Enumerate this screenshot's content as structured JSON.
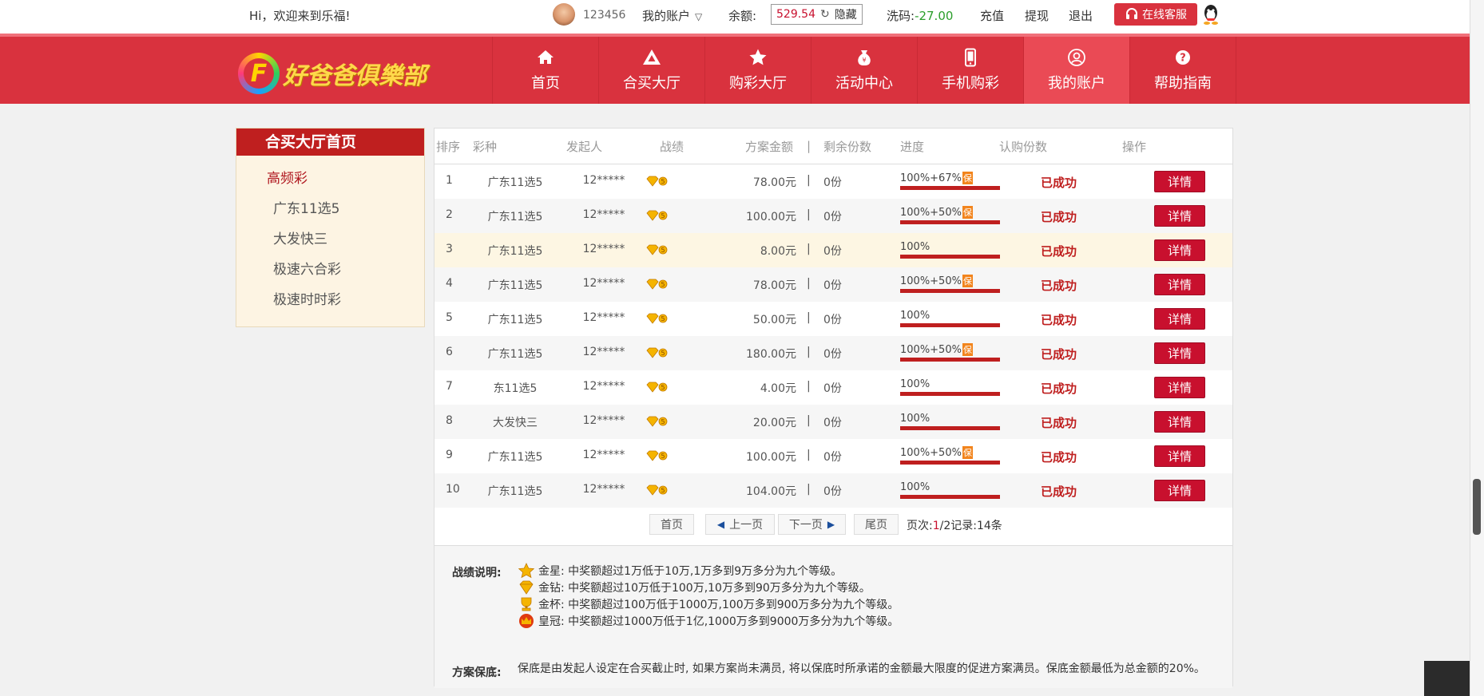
{
  "topbar": {
    "welcome": "Hi，欢迎来到乐福!",
    "user_id": "123456",
    "my_account": "我的账户",
    "balance_label": "余额:",
    "balance_value": "529.54",
    "hide_label": "隐藏",
    "wash_label": "洗码:",
    "wash_value": "-27.00",
    "deposit": "充值",
    "withdraw": "提现",
    "logout": "退出",
    "service": "在线客服"
  },
  "logo": {
    "text": "好爸爸俱樂部"
  },
  "nav": [
    {
      "label": "首页",
      "icon": "home-icon"
    },
    {
      "label": "合买大厅",
      "icon": "triangle-icon"
    },
    {
      "label": "购彩大厅",
      "icon": "star-icon"
    },
    {
      "label": "活动中心",
      "icon": "moneybag-icon"
    },
    {
      "label": "手机购彩",
      "icon": "phone-icon"
    },
    {
      "label": "我的账户",
      "icon": "user-icon"
    },
    {
      "label": "帮助指南",
      "icon": "help-icon"
    }
  ],
  "sidebar": {
    "title": "合买大厅首页",
    "category": "高频彩",
    "items": [
      "广东11选5",
      "大发快三",
      "极速六合彩",
      "极速时时彩"
    ]
  },
  "table": {
    "headers": [
      "排序",
      "彩种",
      "发起人",
      "战绩",
      "方案金额",
      "|",
      "剩余份数",
      "进度",
      "认购份数",
      "操作"
    ],
    "rows": [
      {
        "rank": "1",
        "game": "广东11选5",
        "initiator": "12*****",
        "amount": "78.00元",
        "remain": "0份",
        "progress": "100%+67%",
        "guarantee": "保",
        "status": "已成功",
        "action": "详情"
      },
      {
        "rank": "2",
        "game": "广东11选5",
        "initiator": "12*****",
        "amount": "100.00元",
        "remain": "0份",
        "progress": "100%+50%",
        "guarantee": "保",
        "status": "已成功",
        "action": "详情"
      },
      {
        "rank": "3",
        "game": "广东11选5",
        "initiator": "12*****",
        "amount": "8.00元",
        "remain": "0份",
        "progress": "100%",
        "guarantee": "",
        "status": "已成功",
        "action": "详情"
      },
      {
        "rank": "4",
        "game": "广东11选5",
        "initiator": "12*****",
        "amount": "78.00元",
        "remain": "0份",
        "progress": "100%+50%",
        "guarantee": "保",
        "status": "已成功",
        "action": "详情"
      },
      {
        "rank": "5",
        "game": "广东11选5",
        "initiator": "12*****",
        "amount": "50.00元",
        "remain": "0份",
        "progress": "100%",
        "guarantee": "",
        "status": "已成功",
        "action": "详情"
      },
      {
        "rank": "6",
        "game": "广东11选5",
        "initiator": "12*****",
        "amount": "180.00元",
        "remain": "0份",
        "progress": "100%+50%",
        "guarantee": "保",
        "status": "已成功",
        "action": "详情"
      },
      {
        "rank": "7",
        "game": "东11选5",
        "initiator": "12*****",
        "amount": "4.00元",
        "remain": "0份",
        "progress": "100%",
        "guarantee": "",
        "status": "已成功",
        "action": "详情"
      },
      {
        "rank": "8",
        "game": "大发快三",
        "initiator": "12*****",
        "amount": "20.00元",
        "remain": "0份",
        "progress": "100%",
        "guarantee": "",
        "status": "已成功",
        "action": "详情"
      },
      {
        "rank": "9",
        "game": "广东11选5",
        "initiator": "12*****",
        "amount": "100.00元",
        "remain": "0份",
        "progress": "100%+50%",
        "guarantee": "保",
        "status": "已成功",
        "action": "详情"
      },
      {
        "rank": "10",
        "game": "广东11选5",
        "initiator": "12*****",
        "amount": "104.00元",
        "remain": "0份",
        "progress": "100%",
        "guarantee": "",
        "status": "已成功",
        "action": "详情"
      }
    ]
  },
  "pager": {
    "first": "首页",
    "prev": "上一页",
    "next": "下一页",
    "last": "尾页",
    "page_label": "页次:",
    "current": "1",
    "total_text": "/2记录:14条"
  },
  "explain": {
    "record_label": "战绩说明:",
    "lines": [
      {
        "icon": "gold-star-icon",
        "text": "金星: 中奖额超过1万低于10万,1万多到9万多分为九个等级。"
      },
      {
        "icon": "gold-diamond-icon",
        "text": "金钻: 中奖额超过10万低于100万,10万多到90万多分为九个等级。"
      },
      {
        "icon": "gold-cup-icon",
        "text": "金杯: 中奖额超过100万低于1000万,100万多到900万多分为九个等级。"
      },
      {
        "icon": "crown-icon",
        "text": "皇冠: 中奖额超过1000万低于1亿,1000万多到9000万多分为九个等级。"
      }
    ],
    "guarantee_label": "方案保底:",
    "guarantee_text": "保底是由发起人设定在合买截止时, 如果方案尚未满员, 将以保底时所承诺的金额最大限度的促进方案满员。保底金额最低为总金额的20%。"
  },
  "colors": {
    "brand_red": "#d9323e",
    "dark_red": "#bf1f1f",
    "button_red": "#c8102e",
    "wash_green": "#2a9d2a",
    "guarantee_orange": "#f2841c"
  }
}
